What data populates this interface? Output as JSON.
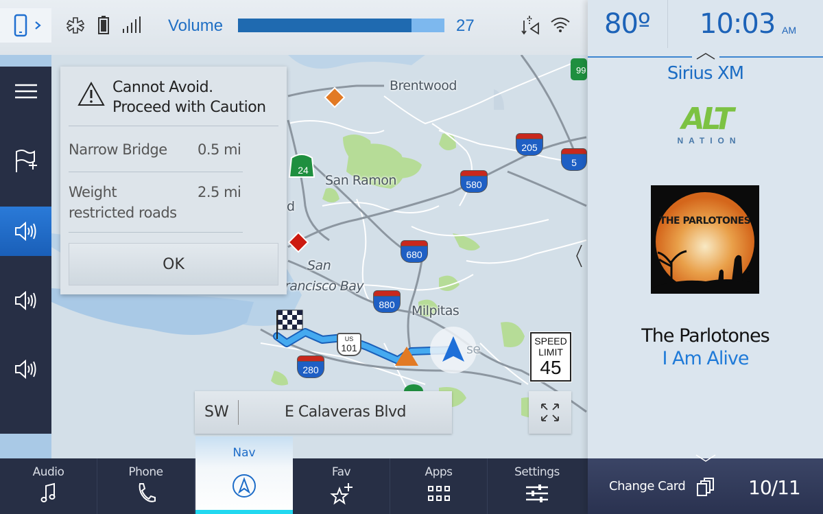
{
  "status_bar": {
    "phone_icon": "smartphone-icon",
    "icons": [
      "asterisk-icon",
      "battery-icon",
      "signal-icon",
      "gps-icon",
      "wifi-icon"
    ],
    "volume_label": "Volume",
    "volume_value": "27",
    "volume_fraction": 0.84
  },
  "climate": {
    "temperature": "80º"
  },
  "clock": {
    "time": "10:03",
    "ampm": "AM"
  },
  "sidebar": {
    "items": [
      {
        "name": "menu",
        "icon": "hamburger-icon"
      },
      {
        "name": "add-waypoint",
        "icon": "flag-plus-icon"
      },
      {
        "name": "voice-guidance-full",
        "icon": "speaker-loud-icon",
        "active": true
      },
      {
        "name": "voice-guidance-alerts",
        "icon": "speaker-icon"
      },
      {
        "name": "voice-guidance-off",
        "icon": "speaker-icon"
      }
    ]
  },
  "dialog": {
    "title_line1": "Cannot Avoid.",
    "title_line2": "Proceed with Caution",
    "icon": "warning-icon",
    "rows": [
      {
        "label_line1": "Narrow Bridge",
        "label_line2": "",
        "distance": "0.5 mi"
      },
      {
        "label_line1": "Weight",
        "label_line2": "restricted roads",
        "distance": "2.5 mi"
      }
    ],
    "ok_label": "OK"
  },
  "map": {
    "labels": [
      "Brentwood",
      "San Ramon",
      "San",
      "rancisco Bay",
      "Milpitas",
      "se",
      "d"
    ],
    "shields": [
      {
        "type": "state",
        "number": "24"
      },
      {
        "type": "interstate",
        "number": "205"
      },
      {
        "type": "interstate",
        "number": "5"
      },
      {
        "type": "interstate",
        "number": "580"
      },
      {
        "type": "interstate",
        "number": "680"
      },
      {
        "type": "interstate",
        "number": "880"
      },
      {
        "type": "interstate",
        "number": "280"
      },
      {
        "type": "us",
        "prefix": "US",
        "number": "101"
      },
      {
        "type": "state",
        "number": "99"
      }
    ],
    "speed_limit_label_1": "SPEED",
    "speed_limit_label_2": "LIMIT",
    "speed_limit_value": "45",
    "heading": "SW",
    "street": "E Calaveras Blvd"
  },
  "bottom_nav": {
    "tabs": [
      {
        "label": "Audio",
        "icon": "music-note-icon"
      },
      {
        "label": "Phone",
        "icon": "phone-handset-icon"
      },
      {
        "label": "Nav",
        "icon": "navigation-arrow-icon",
        "active": true
      },
      {
        "label": "Fav",
        "icon": "star-plus-icon"
      },
      {
        "label": "Apps",
        "icon": "apps-grid-icon"
      },
      {
        "label": "Settings",
        "icon": "sliders-icon"
      }
    ]
  },
  "media_card": {
    "source": "Sirius XM",
    "channel_logo_text": "ALT",
    "channel_logo_sub": "NATION",
    "album_art_text": "THE PARLOTONES",
    "artist": "The Parlotones",
    "song": "I Am Alive",
    "change_card_label": "Change Card",
    "card_position": "10/11"
  },
  "colors": {
    "accent": "#1d63b8",
    "nav_dark": "#272f45",
    "active_blue": "#1a6cd0",
    "route": "#3aa0ee",
    "alt_green": "#7cc243"
  }
}
